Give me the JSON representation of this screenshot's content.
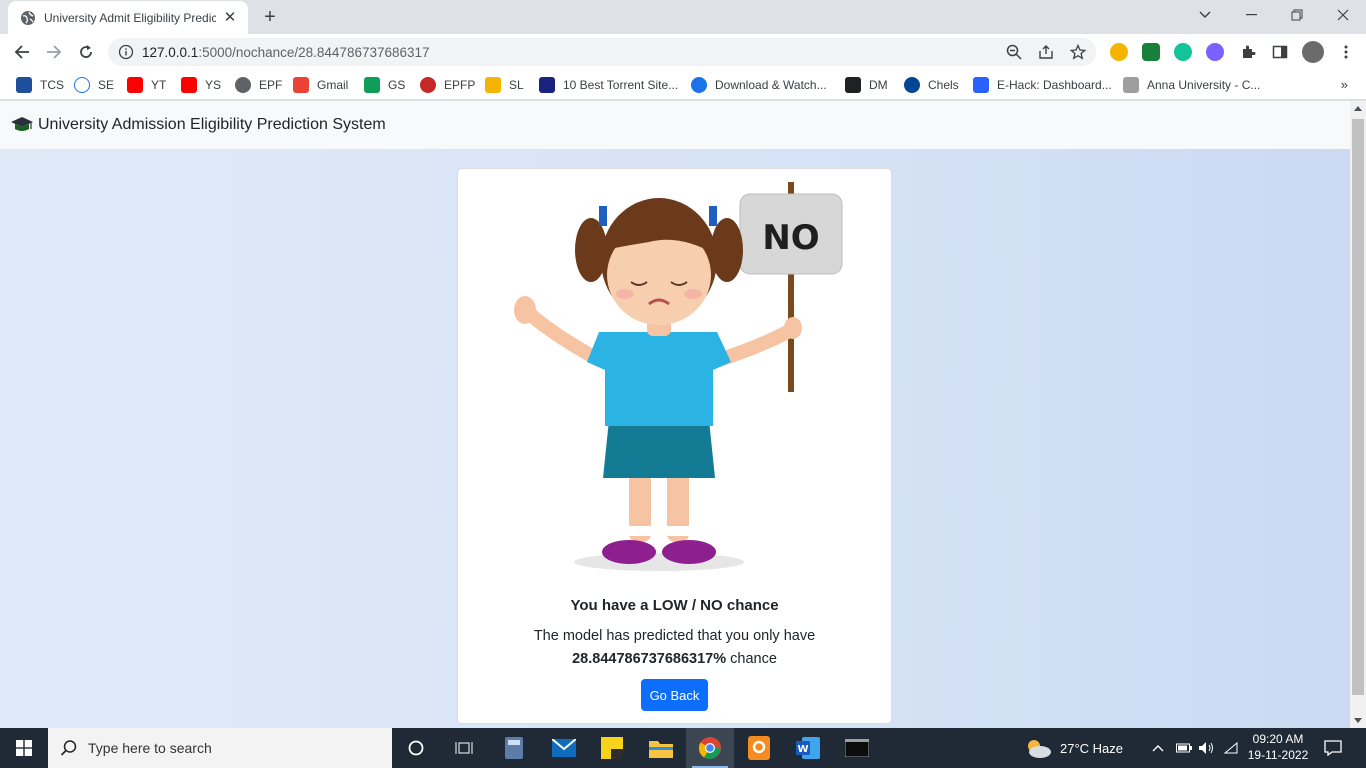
{
  "browser": {
    "tab_title": "University Admit Eligibility Predic",
    "url_host": "127.0.0.1",
    "url_rest": ":5000/nochance/28.844786737686317"
  },
  "bookmarks": [
    "TCS",
    "SE",
    "YT",
    "YS",
    "EPF",
    "Gmail",
    "GS",
    "EPFP",
    "SL",
    "10 Best Torrent Site...",
    "Download & Watch...",
    "DM",
    "Chels",
    "E-Hack: Dashboard...",
    "Anna University - C..."
  ],
  "bookmarks_more": "»",
  "page": {
    "brand": "University Admission Eligibility Prediction System",
    "sign_text": "NO",
    "title": "You have a LOW / NO chance",
    "text_line1": "The model has predicted that you only have",
    "chance_value": "28.844786737686317%",
    "chance_suffix": " chance",
    "button_label": "Go Back"
  },
  "taskbar": {
    "search_placeholder": "Type here to search",
    "weather": "27°C  Haze",
    "time": "09:20 AM",
    "date": "19-11-2022"
  },
  "colors": {
    "accent": "#0d6efd",
    "page_bg": "#d6e3f6",
    "taskbar": "#1f2a36"
  }
}
